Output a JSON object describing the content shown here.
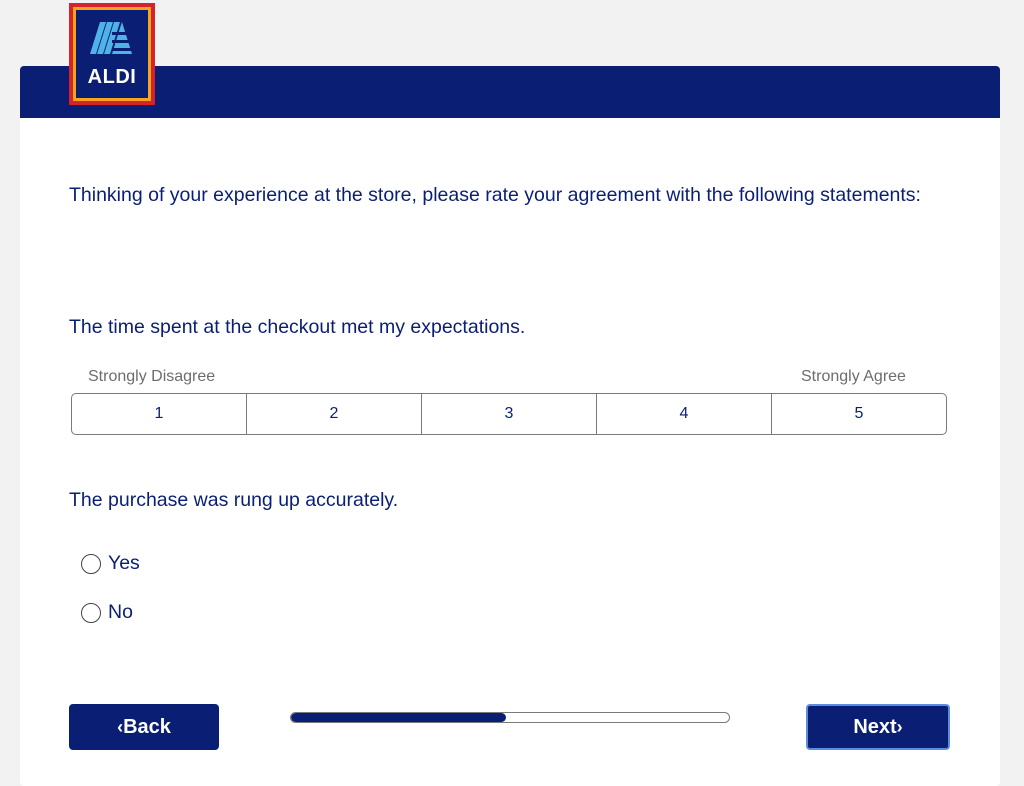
{
  "brand": {
    "logo_text": "ALDI",
    "primary_color": "#0a1f73",
    "logo_red": "#d6222a",
    "logo_orange": "#f8a51a"
  },
  "intro": "Thinking of your experience at the store, please rate your agreement with the following statements:",
  "question1": {
    "text": "The time spent at the checkout met my expectations.",
    "anchor_low": "Strongly Disagree",
    "anchor_high": "Strongly Agree",
    "options": [
      "1",
      "2",
      "3",
      "4",
      "5"
    ]
  },
  "question2": {
    "text": "The purchase was rung up accurately.",
    "options": [
      "Yes",
      "No"
    ]
  },
  "nav": {
    "back_label": "Back",
    "back_icon": "chevron-left-icon",
    "next_label": "Next",
    "next_icon": "chevron-right-icon",
    "progress_fraction": 0.49
  }
}
